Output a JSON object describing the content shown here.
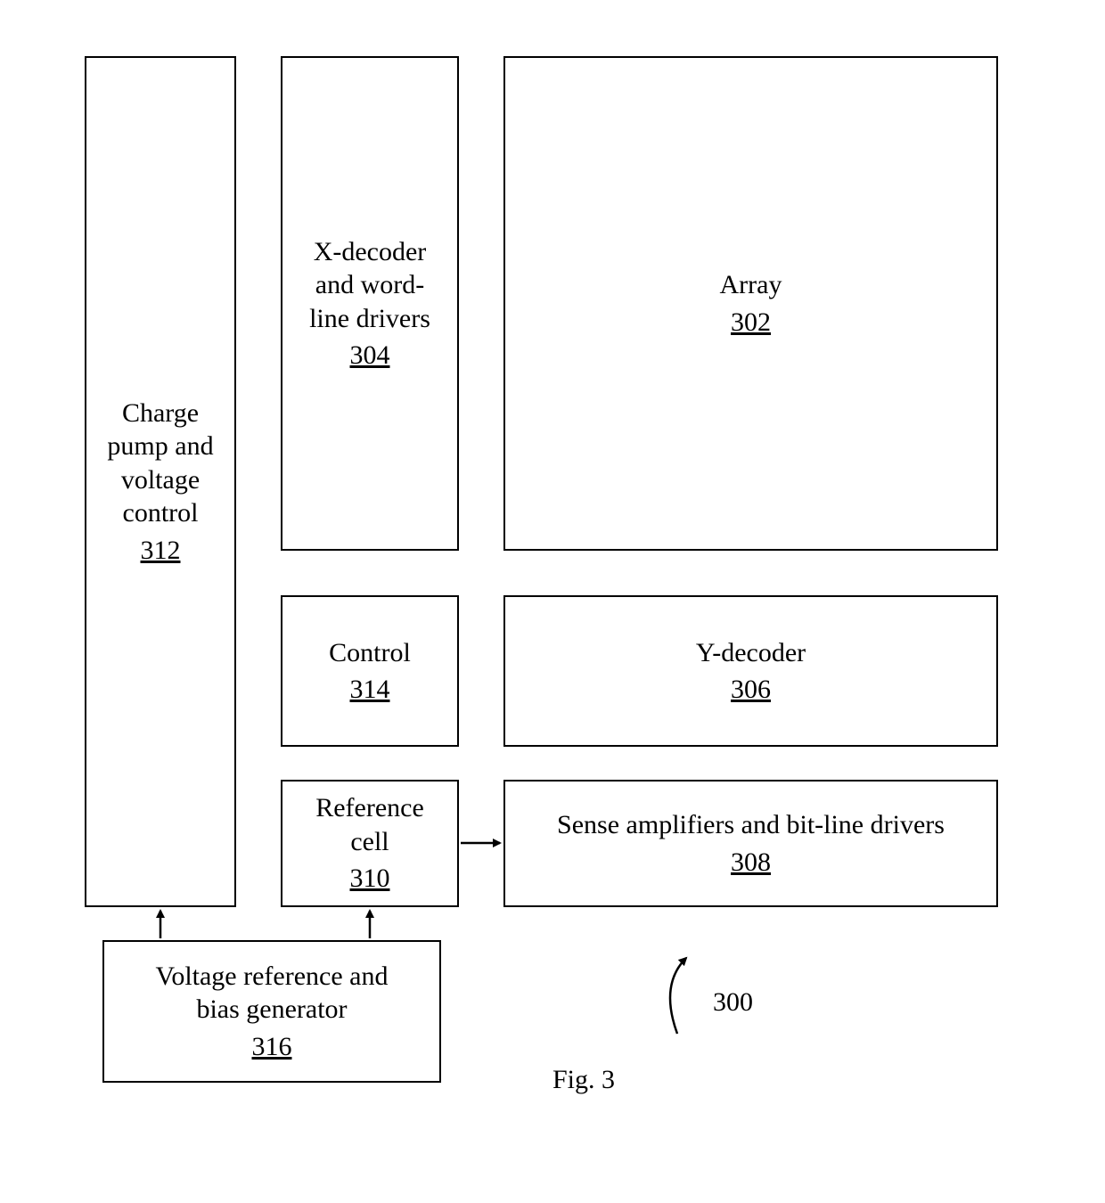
{
  "blocks": {
    "charge_pump": {
      "label": "Charge pump and voltage control",
      "ref": "312"
    },
    "x_decoder": {
      "label": "X-decoder and word-line drivers",
      "ref": "304"
    },
    "array": {
      "label": "Array",
      "ref": "302"
    },
    "control": {
      "label": "Control",
      "ref": "314"
    },
    "y_decoder": {
      "label": "Y-decoder",
      "ref": "306"
    },
    "ref_cell": {
      "label": "Reference cell",
      "ref": "310"
    },
    "sense_amp": {
      "label": "Sense amplifiers and bit-line drivers",
      "ref": "308"
    },
    "volt_ref": {
      "label": "Voltage reference and bias generator",
      "ref": "316"
    }
  },
  "figure": {
    "number_label": "300",
    "caption": "Fig. 3"
  }
}
